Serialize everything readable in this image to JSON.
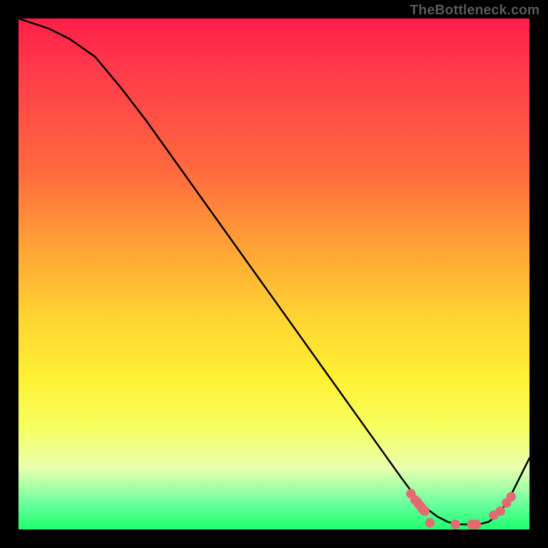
{
  "watermark": "TheBottleneck.com",
  "chart_data": {
    "type": "line",
    "title": "",
    "xlabel": "",
    "ylabel": "",
    "xlim": [
      0,
      100
    ],
    "ylim": [
      0,
      100
    ],
    "series": [
      {
        "name": "curve",
        "x": [
          0,
          3,
          6,
          10,
          15,
          20,
          25,
          30,
          35,
          40,
          45,
          50,
          55,
          60,
          65,
          70,
          75,
          78,
          80,
          82,
          84,
          86,
          88,
          90,
          92,
          94,
          96,
          98,
          100
        ],
        "y": [
          100,
          99,
          98,
          96,
          92.5,
          86.5,
          80,
          73,
          66,
          59,
          52,
          45,
          38,
          31,
          24,
          17,
          10,
          6,
          4,
          2.5,
          1.5,
          1,
          1,
          1,
          1.5,
          3,
          6,
          10,
          14
        ]
      }
    ],
    "markers": {
      "name": "pink-dots",
      "color": "#e46a72",
      "x": [
        76.8,
        77.6,
        78,
        78.3,
        78.8,
        79.1,
        79.3,
        79.5,
        80.5,
        85.5,
        88.7,
        89.6,
        93.0,
        94.3,
        95.5,
        96.4
      ],
      "y": [
        7.0,
        5.8,
        5.4,
        5.0,
        4.4,
        4.0,
        3.8,
        3.6,
        1.3,
        1.0,
        1.0,
        1.0,
        2.8,
        3.6,
        5.2,
        6.4
      ]
    }
  }
}
